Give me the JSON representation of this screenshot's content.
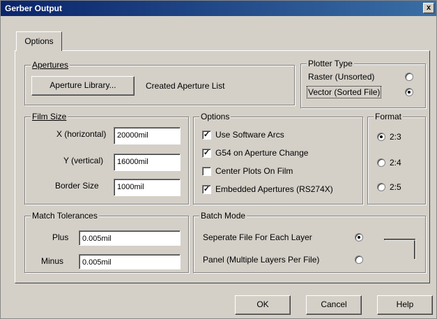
{
  "window": {
    "title": "Gerber Output",
    "close_glyph": "x"
  },
  "tab": {
    "label": "Options"
  },
  "apertures": {
    "title": "Apertures",
    "library_button": "Aperture Library...",
    "status": "Created Aperture List"
  },
  "plotter_type": {
    "title": "Plotter Type",
    "options": [
      {
        "label": "Raster (Unsorted)",
        "selected": false
      },
      {
        "label": "Vector (Sorted File)",
        "selected": true
      }
    ]
  },
  "film_size": {
    "title": "Film Size",
    "x_label": "X (horizontal)",
    "x_value": "20000mil",
    "y_label": "Y (vertical)",
    "y_value": "16000mil",
    "border_label": "Border Size",
    "border_value": "1000mil"
  },
  "options": {
    "title": "Options",
    "items": [
      {
        "label": "Use Software Arcs",
        "checked": true
      },
      {
        "label": "G54 on Aperture Change",
        "checked": true
      },
      {
        "label": "Center Plots On Film",
        "checked": false
      },
      {
        "label": "Embedded Apertures (RS274X)",
        "checked": true
      }
    ],
    "check_glyph": "✓"
  },
  "format": {
    "title": "Format",
    "options": [
      {
        "label": "2:3",
        "selected": true
      },
      {
        "label": "2:4",
        "selected": false
      },
      {
        "label": "2:5",
        "selected": false
      }
    ]
  },
  "match_tolerances": {
    "title": "Match Tolerances",
    "plus_label": "Plus",
    "plus_value": "0.005mil",
    "minus_label": "Minus",
    "minus_value": "0.005mil"
  },
  "batch_mode": {
    "title": "Batch Mode",
    "options": [
      {
        "label": "Seperate File For Each Layer",
        "selected": true
      },
      {
        "label": "Panel (Multiple Layers Per File)",
        "selected": false
      }
    ]
  },
  "footer": {
    "ok": "OK",
    "cancel": "Cancel",
    "help": "Help"
  }
}
